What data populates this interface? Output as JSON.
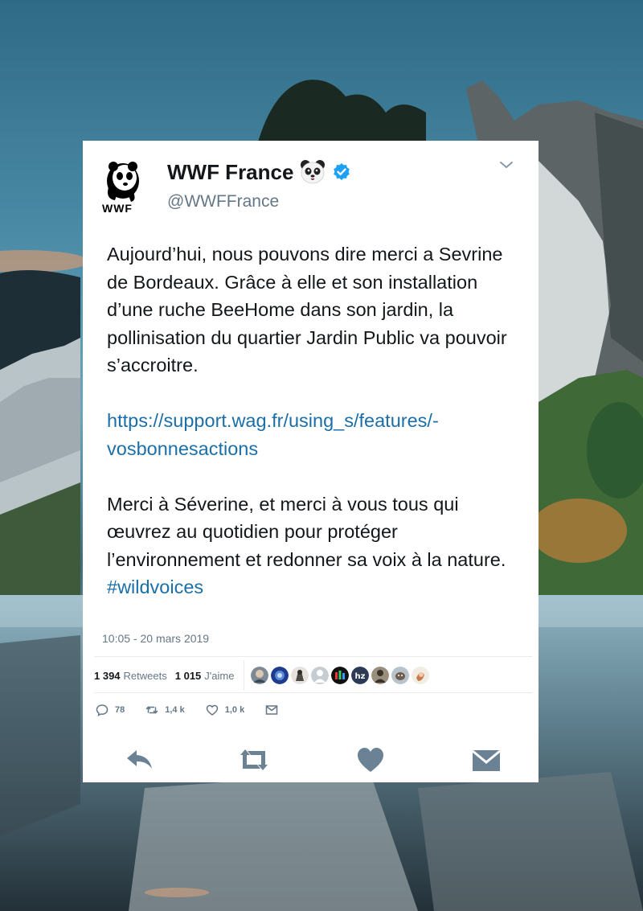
{
  "tweet": {
    "author_name": "WWF France",
    "handle": "@WWFFrance",
    "logo_text": "WWF",
    "paragraph1": "Aujourd’hui, nous pouvons dire merci a Sevrine de Bordeaux. Grâce à elle et son installation d’une ruche BeeHome dans son jardin, la pollinisation du quartier Jardin Public va pouvoir s’accroitre.",
    "link_line1": "https://support.wag.fr/using_s/features/-",
    "link_line2": "vosbonnesactions",
    "paragraph3": "Merci à Séverine, et merci à vous tous qui œuvrez au quotidien pour protéger l’environnement et redonner sa voix à la nature.",
    "hashtag": "#wildvoices",
    "timestamp": "10:05 - 20 mars 2019"
  },
  "stats": {
    "retweets_count": "1 394",
    "retweets_label": "Retweets",
    "likes_count": "1 015",
    "likes_label": "J'aime"
  },
  "actions": {
    "reply_count": "78",
    "retweet_count": "1,4 k",
    "like_count": "1,0 k"
  },
  "icons": [
    "panda-logo",
    "panda-emoji",
    "verified-badge",
    "chevron-down",
    "reply",
    "retweet",
    "heart",
    "envelope"
  ],
  "colors": {
    "link": "#1b6fa8",
    "verified": "#1da1f2",
    "secondary_text": "#657786",
    "action_icon": "#6b8295"
  }
}
